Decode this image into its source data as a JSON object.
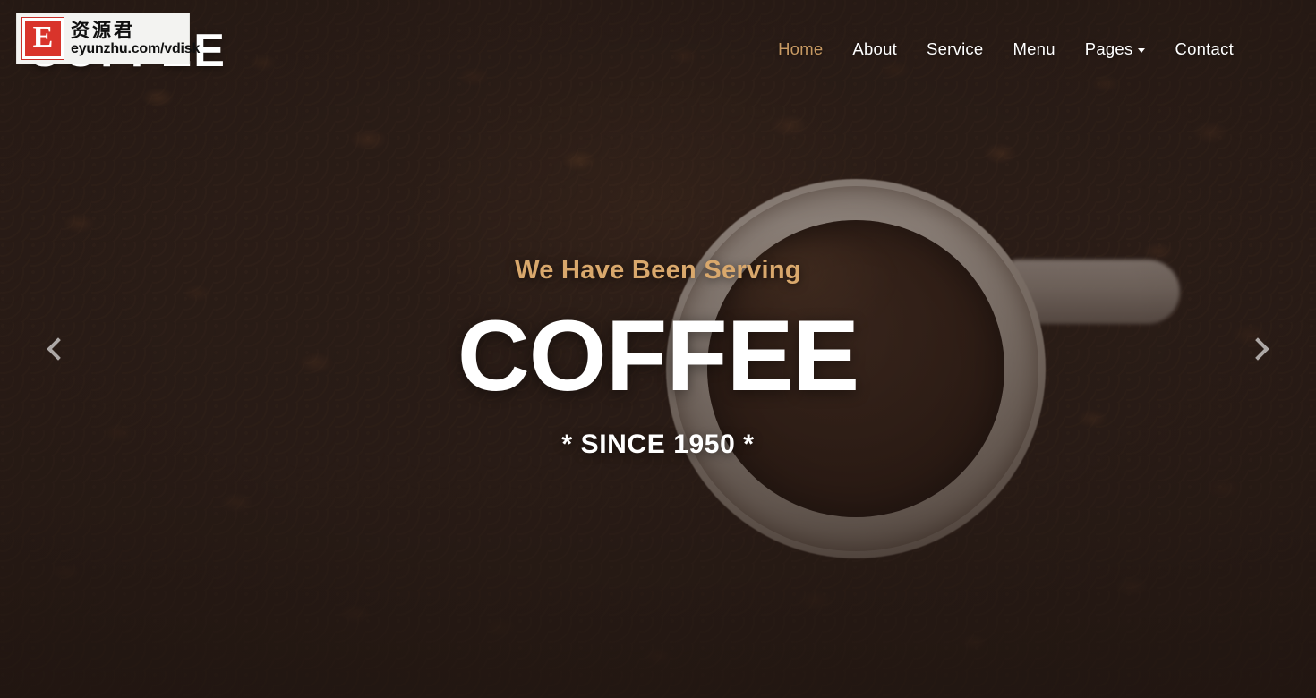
{
  "site": {
    "brand": "COFFEE"
  },
  "nav": {
    "items": [
      {
        "label": "Home",
        "active": true,
        "has_dropdown": false
      },
      {
        "label": "About",
        "active": false,
        "has_dropdown": false
      },
      {
        "label": "Service",
        "active": false,
        "has_dropdown": false
      },
      {
        "label": "Menu",
        "active": false,
        "has_dropdown": false
      },
      {
        "label": "Pages",
        "active": false,
        "has_dropdown": true
      },
      {
        "label": "Contact",
        "active": false,
        "has_dropdown": false
      }
    ]
  },
  "hero": {
    "eyebrow": "We Have Been Serving",
    "title": "COFFEE",
    "subtitle": "* SINCE 1950 *",
    "background_description": "top-down photo of a white coffee mug filled with black coffee resting on roasted coffee beans"
  },
  "carousel": {
    "prev_icon": "chevron-left-icon",
    "next_icon": "chevron-right-icon"
  },
  "watermark": {
    "logo_letter": "E",
    "chinese_text": "资源君",
    "url_text": "eyunzhu.com/vdisk"
  },
  "colors": {
    "accent_gold": "#c89a63",
    "eyebrow_gold": "#d9a86c",
    "text_white": "#ffffff",
    "background_dark": "#2d1f19",
    "watermark_red": "#d9342b"
  }
}
